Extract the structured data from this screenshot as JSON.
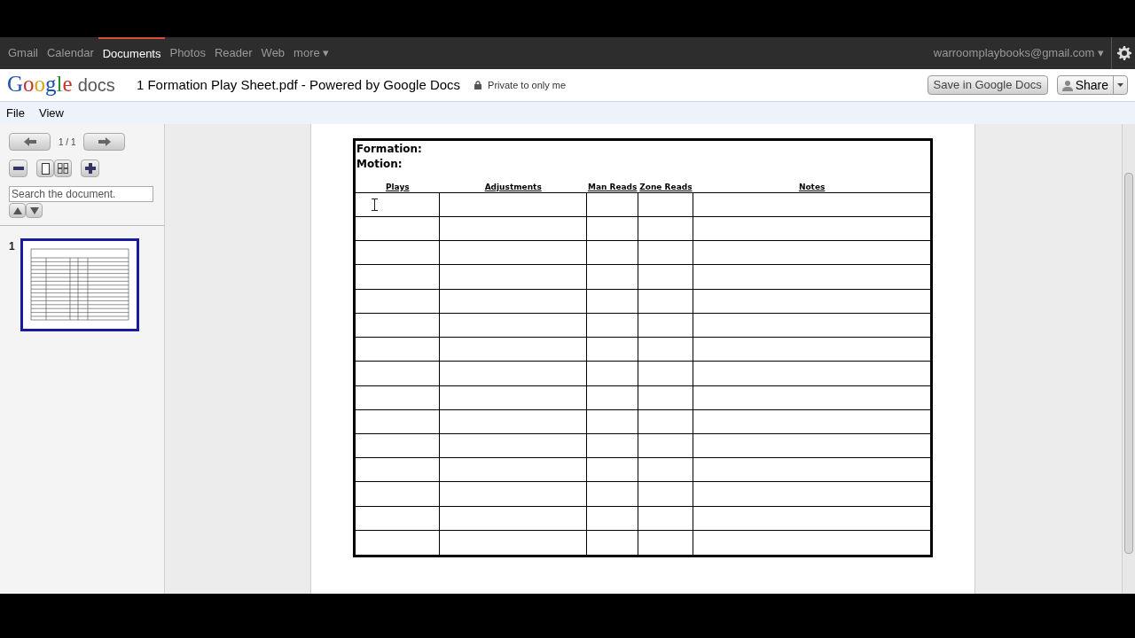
{
  "nav": {
    "items": [
      {
        "label": "Gmail",
        "selected": false
      },
      {
        "label": "Calendar",
        "selected": false
      },
      {
        "label": "Documents",
        "selected": true
      },
      {
        "label": "Photos",
        "selected": false
      },
      {
        "label": "Reader",
        "selected": false
      },
      {
        "label": "Web",
        "selected": false
      },
      {
        "label": "more ▾",
        "selected": false
      }
    ],
    "account": "warroomplaybooks@gmail.com ▾"
  },
  "header": {
    "logo": {
      "brand": "Google",
      "product": "docs"
    },
    "title": "1 Formation Play Sheet.pdf - Powered by Google Docs",
    "privacy": "Private to only me",
    "save_button": "Save in Google Docs",
    "share_button": "Share"
  },
  "menu": [
    "File",
    "View"
  ],
  "sidebar": {
    "page_indicator": "1 / 1",
    "search": {
      "placeholder": "Search the document."
    },
    "thumbnails": [
      {
        "number": "1",
        "selected": true
      }
    ]
  },
  "document": {
    "labels": [
      "Formation:",
      "Motion:"
    ],
    "columns": [
      "Plays",
      "Adjustments",
      "Man Reads",
      "Zone Reads",
      "Notes"
    ]
  }
}
